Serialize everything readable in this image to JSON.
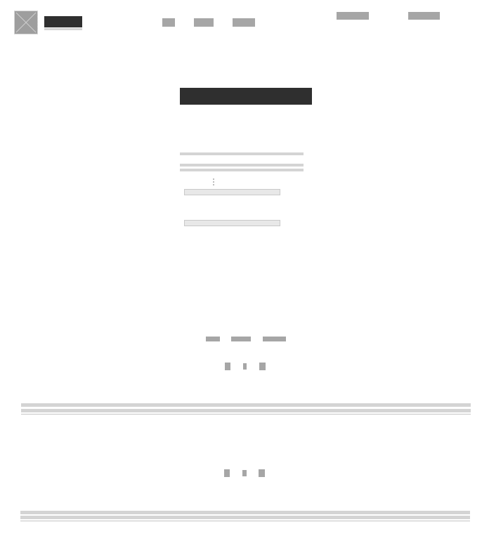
{
  "header": {
    "logo_icon": "broken-image-icon",
    "brand": "",
    "nav": [
      "",
      "",
      ""
    ],
    "actions": [
      "",
      ""
    ]
  },
  "main": {
    "title": "",
    "fields": [
      {
        "placeholder": ""
      },
      {
        "placeholder": ""
      }
    ],
    "links": [
      "",
      "",
      ""
    ],
    "pager_1": [
      "",
      "",
      ""
    ]
  },
  "footer": {
    "pager_2": [
      "",
      "",
      ""
    ]
  },
  "colors": {
    "placeholder_gray": "#a6a6a6",
    "dark_block": "#2f2f2f",
    "rule": "#d4d4d4"
  }
}
